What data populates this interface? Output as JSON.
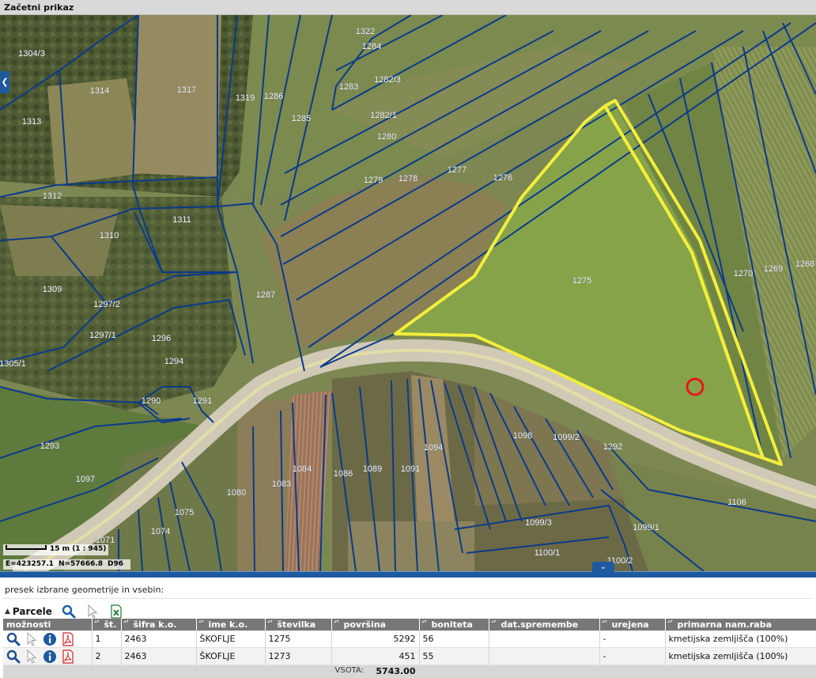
{
  "window": {
    "title": "Začetni prikaz"
  },
  "map": {
    "parcel_labels": [
      "1304/3",
      "1322",
      "1284",
      "1314",
      "1317",
      "1319",
      "1286",
      "1283",
      "1282/3",
      "1313",
      "1285",
      "1282/1",
      "1280",
      "1277",
      "1276",
      "1279",
      "1278",
      "1312",
      "1311",
      "1310",
      "1275",
      "1270",
      "1269",
      "1268",
      "1309",
      "1287",
      "1297/2",
      "1297/1",
      "1296",
      "1305/1",
      "1294",
      "1290",
      "1291",
      "1293",
      "1097",
      "1098",
      "1099/2",
      "1292",
      "1094",
      "1091",
      "1089",
      "1084",
      "1086",
      "1083",
      "1080",
      "1075",
      "1074",
      "1071",
      "1106",
      "1099/3",
      "1099/1",
      "1100/1",
      "1100/2"
    ],
    "selection_color": "#f2ee3c",
    "point_marker_color": "#e8141e",
    "road_color": "#cfc9b6",
    "parcel_line_color": "#0b3a8c",
    "scale": {
      "distance": "15 m",
      "ratio": "(1 : 945)"
    },
    "coords": {
      "e": "E=423257.1",
      "n": "N=57666.8",
      "crs": "D96"
    }
  },
  "panel": {
    "info": "presek izbrane geometrije in vsebin:",
    "section_title": "Parcele",
    "toolbar_icons": [
      "search-icon",
      "pointer-icon",
      "excel-export-icon"
    ],
    "columns": [
      "možnosti",
      "št.",
      "šifra k.o.",
      "ime k.o.",
      "številka",
      "površina",
      "boniteta",
      "dat.spremembe",
      "urejena",
      "primarna nam.raba"
    ],
    "rows": [
      {
        "st": "1",
        "sifra": "2463",
        "ime": "ŠKOFLJE",
        "stevilka": "1275",
        "povrsina": "5292",
        "boniteta": "56",
        "dat": "",
        "urejena": "-",
        "raba": "kmetijska zemljišča (100%)"
      },
      {
        "st": "2",
        "sifra": "2463",
        "ime": "ŠKOFLJE",
        "stevilka": "1273",
        "povrsina": "451",
        "boniteta": "55",
        "dat": "",
        "urejena": "-",
        "raba": "kmetijska zemljišča (100%)"
      }
    ],
    "total": {
      "label": "VSOTA:",
      "value": "5743.00"
    }
  }
}
